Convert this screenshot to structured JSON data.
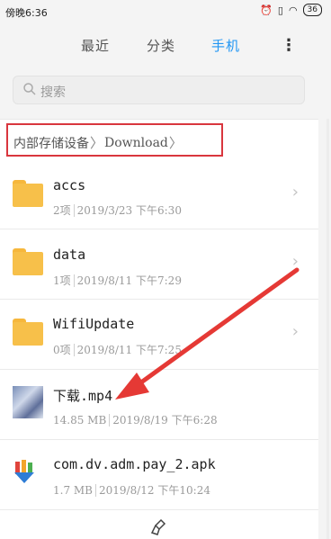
{
  "status": {
    "time": "傍晚6:36",
    "battery": "36"
  },
  "tabs": [
    {
      "label": "最近",
      "active": false
    },
    {
      "label": "分类",
      "active": false
    },
    {
      "label": "手机",
      "active": true
    }
  ],
  "more_icon": "more-vertical-icon",
  "search": {
    "placeholder": "搜索"
  },
  "breadcrumb": {
    "root": "内部存储设备",
    "current": "Download"
  },
  "files": [
    {
      "name": "accs",
      "type": "folder",
      "count": "2项",
      "date": "2019/3/23",
      "time": "下午6:30"
    },
    {
      "name": "data",
      "type": "folder",
      "count": "1项",
      "date": "2019/8/11",
      "time": "下午7:29"
    },
    {
      "name": "WifiUpdate",
      "type": "folder",
      "count": "0项",
      "date": "2019/8/11",
      "time": "下午7:25"
    },
    {
      "name": "下载.mp4",
      "type": "video",
      "size": "14.85 MB",
      "date": "2019/8/19",
      "time": "下午6:28"
    },
    {
      "name": "com.dv.adm.pay_2.apk",
      "type": "apk",
      "size": "1.7 MB",
      "date": "2019/8/12",
      "time": "下午10:24"
    }
  ],
  "colors": {
    "accent": "#2196f3",
    "folder": "#f7c04a",
    "highlight": "#d9363e"
  }
}
